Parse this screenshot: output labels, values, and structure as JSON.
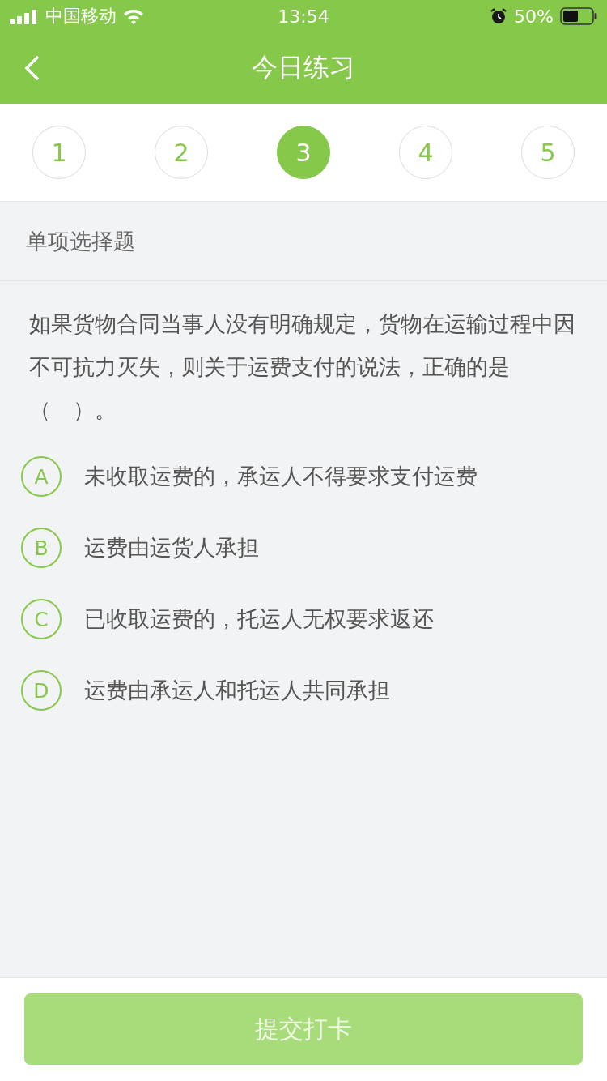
{
  "status_bar": {
    "carrier": "中国移动",
    "time": "13:54",
    "battery": "50%"
  },
  "nav": {
    "title": "今日练习"
  },
  "steps": [
    {
      "label": "1",
      "selected": false
    },
    {
      "label": "2",
      "selected": false
    },
    {
      "label": "3",
      "selected": true
    },
    {
      "label": "4",
      "selected": false
    },
    {
      "label": "5",
      "selected": false
    }
  ],
  "section": {
    "title": "单项选择题"
  },
  "question": {
    "text": "如果货物合同当事人没有明确规定，货物在运输过程中因不可抗力灭失，则关于运费支付的说法，正确的是（　）。",
    "options": [
      {
        "letter": "A",
        "text": "未收取运费的，承运人不得要求支付运费",
        "selected": false
      },
      {
        "letter": "B",
        "text": "运费由运货人承担",
        "selected": false
      },
      {
        "letter": "C",
        "text": "已收取运费的，托运人无权要求返还",
        "selected": false
      },
      {
        "letter": "D",
        "text": "运费由承运人和托运人共同承担",
        "selected": false
      }
    ]
  },
  "submit": {
    "label": "提交打卡",
    "disabled": true
  }
}
